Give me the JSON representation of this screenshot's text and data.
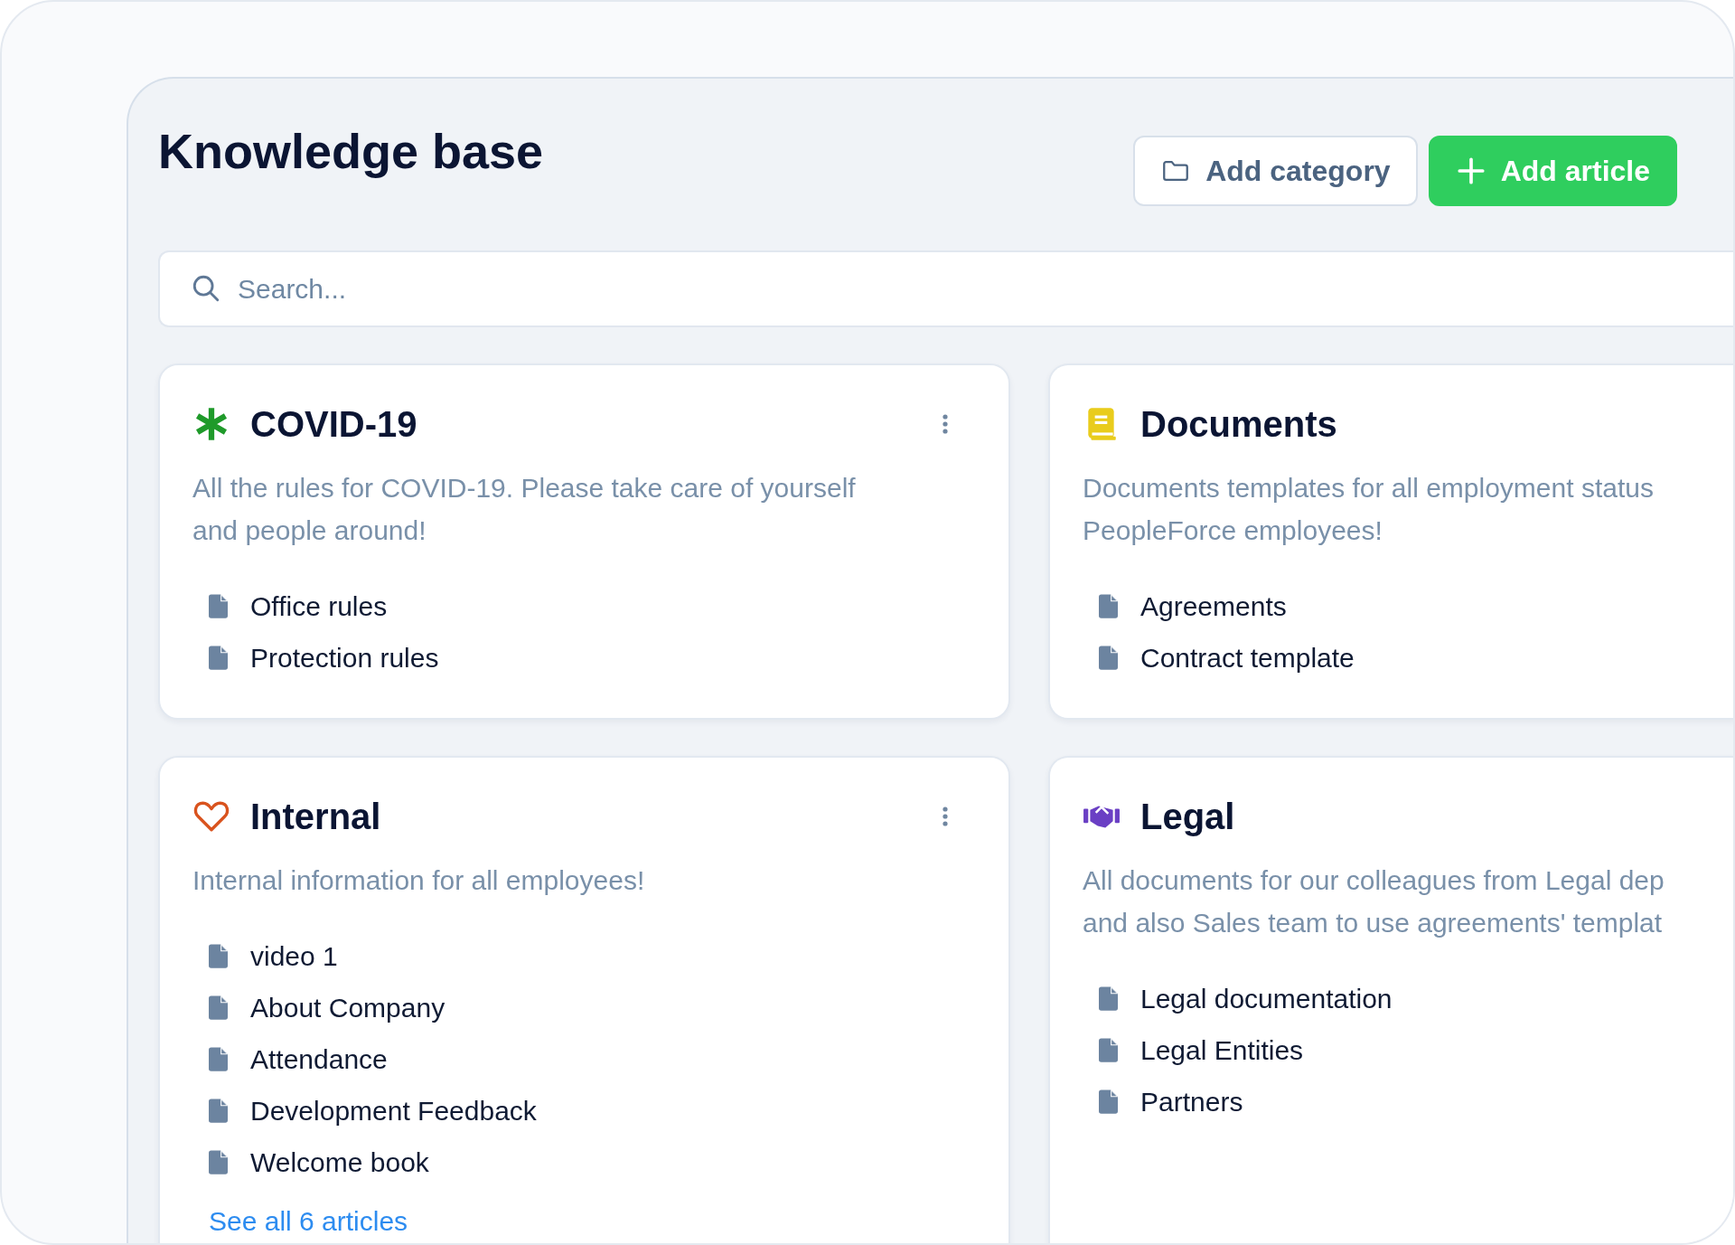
{
  "header": {
    "title": "Knowledge base",
    "buttons": [
      {
        "kind": "secondary",
        "label": "Add category"
      },
      {
        "kind": "primary",
        "label": "Add article"
      }
    ]
  },
  "search": {
    "placeholder": "Search..."
  },
  "categories": [
    {
      "color": "#1f9a2a",
      "title": "COVID-19",
      "menu": true,
      "description": [
        "All the rules for COVID-19. Please take care of yourself",
        "and people around!"
      ],
      "articles": [
        "Office rules",
        "Protection rules"
      ]
    },
    {
      "color": "#e9cc1c",
      "title": "Documents",
      "menu": false,
      "description": [
        "Documents templates for all employment status",
        "PeopleForce employees!"
      ],
      "articles": [
        "Agreements",
        "Contract template"
      ]
    },
    {
      "color": "#d9531e",
      "title": "Internal",
      "menu": true,
      "description": [
        "Internal information for all employees!"
      ],
      "articles": [
        "video 1",
        "About Company",
        "Attendance",
        "Development Feedback",
        "Welcome book"
      ],
      "see_all": "See all 6 articles"
    },
    {
      "color": "#6a3fc4",
      "title": "Legal",
      "menu": false,
      "description": [
        "All documents for our colleagues from Legal dep",
        "and also Sales team to use agreements' templat"
      ],
      "articles": [
        "Legal documentation",
        "Legal Entities",
        "Partners"
      ]
    }
  ]
}
